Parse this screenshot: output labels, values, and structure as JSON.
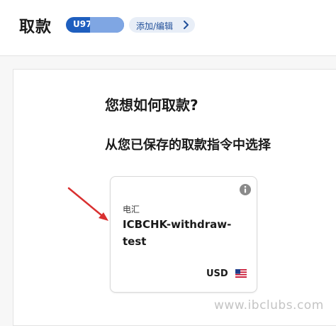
{
  "header": {
    "title": "取款",
    "account_badge": "U97",
    "edit_link": "添加/编辑"
  },
  "main": {
    "question": "您想如何取款?",
    "subheading": "从您已保存的取款指令中选择"
  },
  "instruction_card": {
    "method": "电汇",
    "name": "ICBCHK-withdraw-test",
    "currency": "USD",
    "info_icon": "info-icon",
    "flag_icon": "us-flag-icon"
  },
  "watermark": "www.ibclubs.com",
  "colors": {
    "badge": "#1f5fbf",
    "edit_link_bg": "#e8eef7",
    "edit_link_text": "#1f4e99",
    "arrow": "#d93030"
  }
}
